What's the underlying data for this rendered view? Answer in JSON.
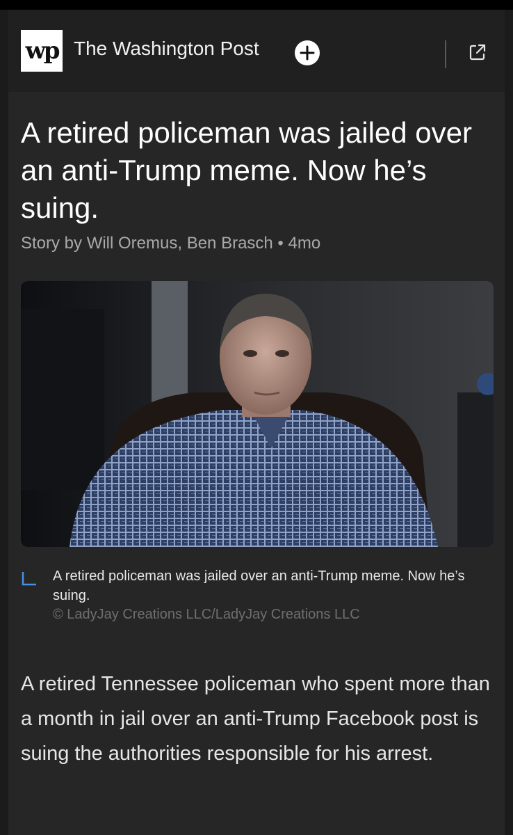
{
  "header": {
    "logo_text": "wp",
    "publication": "The Washington Post",
    "follow_icon": "plus-icon",
    "open_icon": "external-link-icon"
  },
  "article": {
    "title": "A retired policeman was jailed over an anti-Trump meme. Now he’s suing.",
    "byline": "Story by Will Oremus, Ben Brasch • 4mo",
    "image_alt": "Retired policeman in a plaid shirt seated in a dark leather armchair",
    "caption": "A retired policeman was jailed over an anti-Trump meme. Now he’s suing.",
    "credit": "© LadyJay Creations LLC/LadyJay Creations LLC",
    "body": "A retired Tennessee policeman who spent more than a month in jail over an anti-Trump Facebook post is suing the authorities responsible for his arrest."
  },
  "colors": {
    "background": "#1b1b1b",
    "card": "#262626",
    "header": "#202020",
    "accent": "#4a90e2",
    "muted_text": "#a9a9a9"
  }
}
